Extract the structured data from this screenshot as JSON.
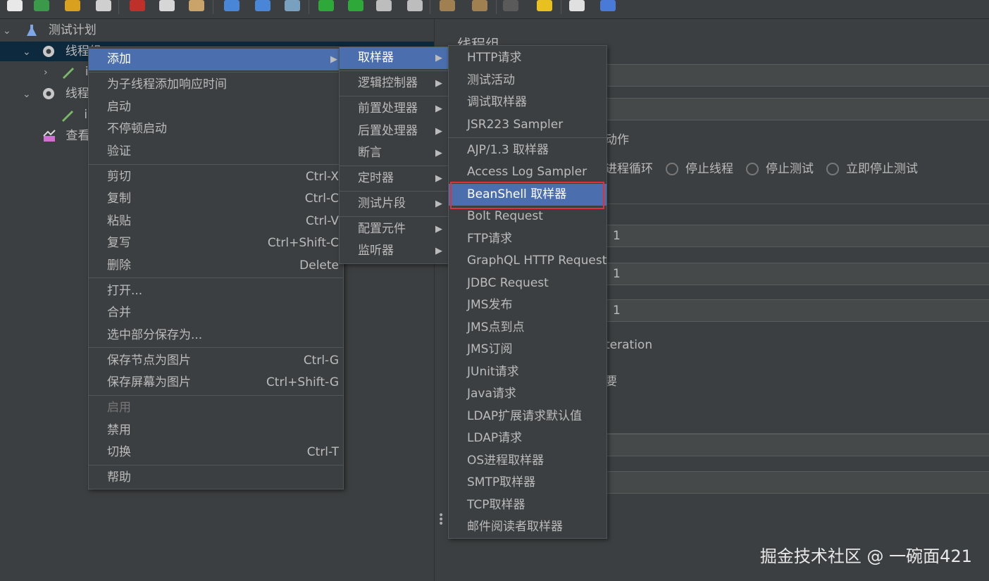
{
  "toolbar": {
    "icons": [
      "new-icon",
      "templates-icon",
      "open-icon",
      "save-icon",
      "cut-icon",
      "copy-icon",
      "paste-icon",
      "expand-icon",
      "collapse-icon",
      "toggle-icon",
      "start-icon",
      "start-no-pause-icon",
      "stop-icon",
      "shutdown-icon",
      "clear-icon",
      "clear-all-icon",
      "search-icon",
      "reset-search-icon",
      "function-helper-icon",
      "help-icon"
    ]
  },
  "tree": {
    "items": [
      {
        "label": "测试计划",
        "icon": "test-plan-icon"
      },
      {
        "label": "线程组",
        "icon": "gear-icon"
      },
      {
        "label": "i",
        "icon": "sampler-icon"
      },
      {
        "label": "线程组",
        "icon": "gear-icon"
      },
      {
        "label": "i",
        "icon": "sampler-icon"
      },
      {
        "label": "查看",
        "icon": "listener-icon"
      }
    ]
  },
  "right": {
    "title": "线程组",
    "action_label": "动作",
    "radio_options": [
      "进程循环",
      "停止线程",
      "停止测试",
      "立即停止测试"
    ],
    "field_values": [
      "1",
      "1",
      "1"
    ],
    "iteration_text": "teration",
    "needed_text": "要"
  },
  "context_menu": {
    "items": [
      {
        "label": "添加",
        "shortcut": "",
        "submenu": true
      },
      {
        "label": "为子线程添加响应时间",
        "shortcut": ""
      },
      {
        "label": "启动",
        "shortcut": ""
      },
      {
        "label": "不停顿启动",
        "shortcut": ""
      },
      {
        "label": "验证",
        "shortcut": ""
      },
      {
        "label": "剪切",
        "shortcut": "Ctrl-X"
      },
      {
        "label": "复制",
        "shortcut": "Ctrl-C"
      },
      {
        "label": "粘贴",
        "shortcut": "Ctrl-V"
      },
      {
        "label": "复写",
        "shortcut": "Ctrl+Shift-C"
      },
      {
        "label": "删除",
        "shortcut": "Delete"
      },
      {
        "label": "打开...",
        "shortcut": ""
      },
      {
        "label": "合并",
        "shortcut": ""
      },
      {
        "label": "选中部分保存为...",
        "shortcut": ""
      },
      {
        "label": "保存节点为图片",
        "shortcut": "Ctrl-G"
      },
      {
        "label": "保存屏幕为图片",
        "shortcut": "Ctrl+Shift-G"
      },
      {
        "label": "启用",
        "shortcut": ""
      },
      {
        "label": "禁用",
        "shortcut": ""
      },
      {
        "label": "切换",
        "shortcut": "Ctrl-T"
      },
      {
        "label": "帮助",
        "shortcut": ""
      }
    ]
  },
  "add_submenu": {
    "items": [
      "取样器",
      "逻辑控制器",
      "前置处理器",
      "后置处理器",
      "断言",
      "定时器",
      "测试片段",
      "配置元件",
      "监听器"
    ]
  },
  "sampler_submenu": {
    "items": [
      "HTTP请求",
      "测试活动",
      "调试取样器",
      "JSR223 Sampler",
      "AJP/1.3 取样器",
      "Access Log Sampler",
      "BeanShell 取样器",
      "Bolt Request",
      "FTP请求",
      "GraphQL HTTP Request",
      "JDBC Request",
      "JMS发布",
      "JMS点到点",
      "JMS订阅",
      "JUnit请求",
      "Java请求",
      "LDAP扩展请求默认值",
      "LDAP请求",
      "OS进程取样器",
      "SMTP取样器",
      "TCP取样器",
      "邮件阅读者取样器"
    ],
    "selected": "BeanShell 取样器"
  },
  "watermark": "掘金技术社区 @ 一碗面421",
  "colors": {
    "background": "#3c3f41",
    "highlight": "#4b6eaf",
    "annotation_box": "#e0303a"
  }
}
